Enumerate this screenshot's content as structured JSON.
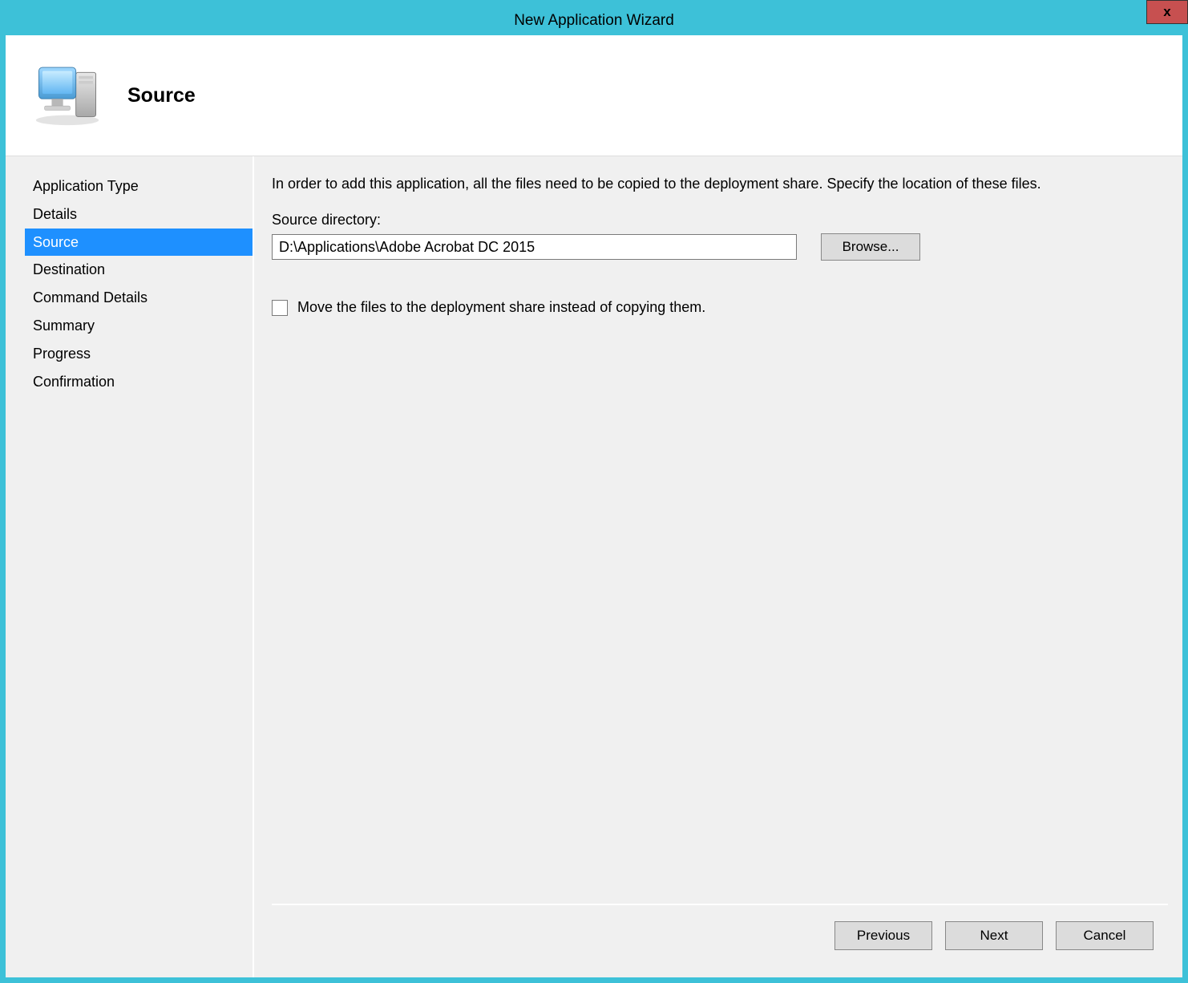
{
  "window": {
    "title": "New Application Wizard",
    "close_label": "x"
  },
  "header": {
    "page_title": "Source"
  },
  "sidebar": {
    "items": [
      {
        "label": "Application Type",
        "selected": false
      },
      {
        "label": "Details",
        "selected": false
      },
      {
        "label": "Source",
        "selected": true
      },
      {
        "label": "Destination",
        "selected": false
      },
      {
        "label": "Command Details",
        "selected": false
      },
      {
        "label": "Summary",
        "selected": false
      },
      {
        "label": "Progress",
        "selected": false
      },
      {
        "label": "Confirmation",
        "selected": false
      }
    ]
  },
  "main": {
    "instruction": "In order to add this application, all the files need to be copied to the deployment share.  Specify the location of these files.",
    "source_dir_label": "Source directory:",
    "source_dir_value": "D:\\Applications\\Adobe Acrobat DC 2015",
    "browse_label": "Browse...",
    "move_checkbox_label": "Move the files to the deployment share instead of copying them.",
    "move_checked": false
  },
  "footer": {
    "previous_label": "Previous",
    "next_label": "Next",
    "cancel_label": "Cancel"
  }
}
